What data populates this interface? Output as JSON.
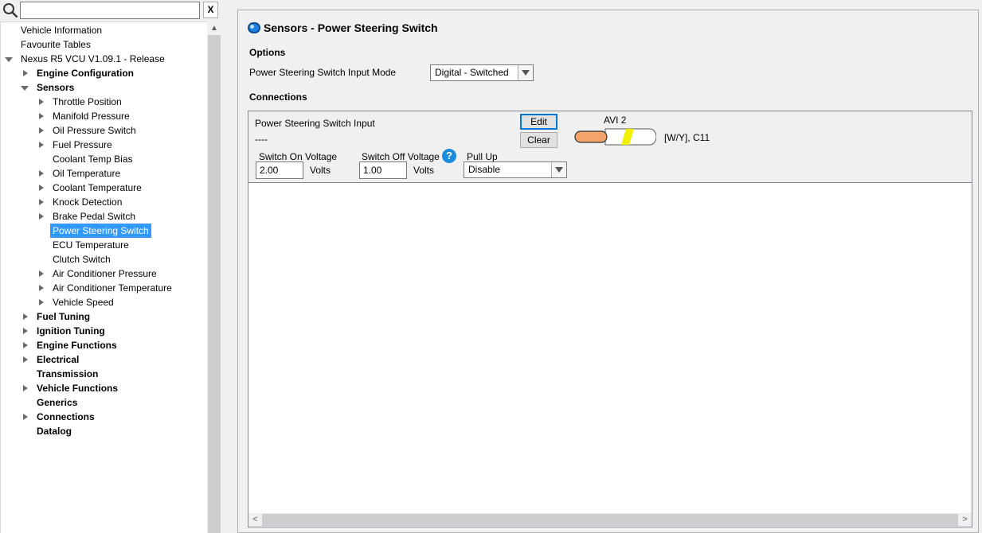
{
  "search": {
    "value": "",
    "clear_label": "X"
  },
  "tree": {
    "items": [
      {
        "label": "Vehicle Information",
        "level": 0,
        "arrow": "none",
        "bold": false
      },
      {
        "label": "Favourite Tables",
        "level": 0,
        "arrow": "none",
        "bold": false
      },
      {
        "label": "Nexus R5 VCU V1.09.1 - Release",
        "level": 0,
        "arrow": "down",
        "bold": false
      },
      {
        "label": "Engine Configuration",
        "level": 1,
        "arrow": "right",
        "bold": true
      },
      {
        "label": "Sensors",
        "level": 1,
        "arrow": "down",
        "bold": true
      },
      {
        "label": "Throttle Position",
        "level": 2,
        "arrow": "right",
        "bold": false
      },
      {
        "label": "Manifold Pressure",
        "level": 2,
        "arrow": "right",
        "bold": false
      },
      {
        "label": "Oil Pressure Switch",
        "level": 2,
        "arrow": "right",
        "bold": false
      },
      {
        "label": "Fuel Pressure",
        "level": 2,
        "arrow": "right",
        "bold": false
      },
      {
        "label": "Coolant Temp Bias",
        "level": 2,
        "arrow": "none",
        "bold": false
      },
      {
        "label": "Oil Temperature",
        "level": 2,
        "arrow": "right",
        "bold": false
      },
      {
        "label": "Coolant Temperature",
        "level": 2,
        "arrow": "right",
        "bold": false
      },
      {
        "label": "Knock Detection",
        "level": 2,
        "arrow": "right",
        "bold": false
      },
      {
        "label": "Brake Pedal Switch",
        "level": 2,
        "arrow": "right",
        "bold": false
      },
      {
        "label": "Power Steering Switch",
        "level": 2,
        "arrow": "none",
        "bold": false,
        "selected": true
      },
      {
        "label": "ECU Temperature",
        "level": 2,
        "arrow": "none",
        "bold": false
      },
      {
        "label": "Clutch Switch",
        "level": 2,
        "arrow": "none",
        "bold": false
      },
      {
        "label": "Air Conditioner Pressure",
        "level": 2,
        "arrow": "right",
        "bold": false
      },
      {
        "label": "Air Conditioner Temperature",
        "level": 2,
        "arrow": "right",
        "bold": false
      },
      {
        "label": "Vehicle Speed",
        "level": 2,
        "arrow": "right",
        "bold": false
      },
      {
        "label": "Fuel Tuning",
        "level": 1,
        "arrow": "right",
        "bold": true
      },
      {
        "label": "Ignition Tuning",
        "level": 1,
        "arrow": "right",
        "bold": true
      },
      {
        "label": "Engine Functions",
        "level": 1,
        "arrow": "right",
        "bold": true
      },
      {
        "label": "Electrical",
        "level": 1,
        "arrow": "right",
        "bold": true
      },
      {
        "label": "Transmission",
        "level": 1,
        "arrow": "none",
        "bold": true
      },
      {
        "label": "Vehicle Functions",
        "level": 1,
        "arrow": "right",
        "bold": true
      },
      {
        "label": "Generics",
        "level": 1,
        "arrow": "none",
        "bold": true
      },
      {
        "label": "Connections",
        "level": 1,
        "arrow": "right",
        "bold": true
      },
      {
        "label": "Datalog",
        "level": 1,
        "arrow": "none",
        "bold": true
      }
    ]
  },
  "main": {
    "title": "Sensors - Power Steering Switch",
    "options_label": "Options",
    "mode_label": "Power Steering Switch Input Mode",
    "mode_value": "Digital - Switched",
    "connections_label": "Connections",
    "input_label": "Power Steering Switch Input",
    "input_value": "----",
    "edit_label": "Edit",
    "clear_label": "Clear",
    "pin_name": "AVI 2",
    "wire_info": "[W/Y], C11",
    "wire_colors": {
      "connector": "#f4a46a",
      "stripe": "#f0f000",
      "insulation": "#ffffff"
    },
    "switch_on_label": "Switch On Voltage",
    "switch_on_value": "2.00",
    "switch_off_label": "Switch Off Voltage",
    "switch_off_value": "1.00",
    "volts_label": "Volts",
    "pullup_label": "Pull Up",
    "pullup_value": "Disable"
  }
}
